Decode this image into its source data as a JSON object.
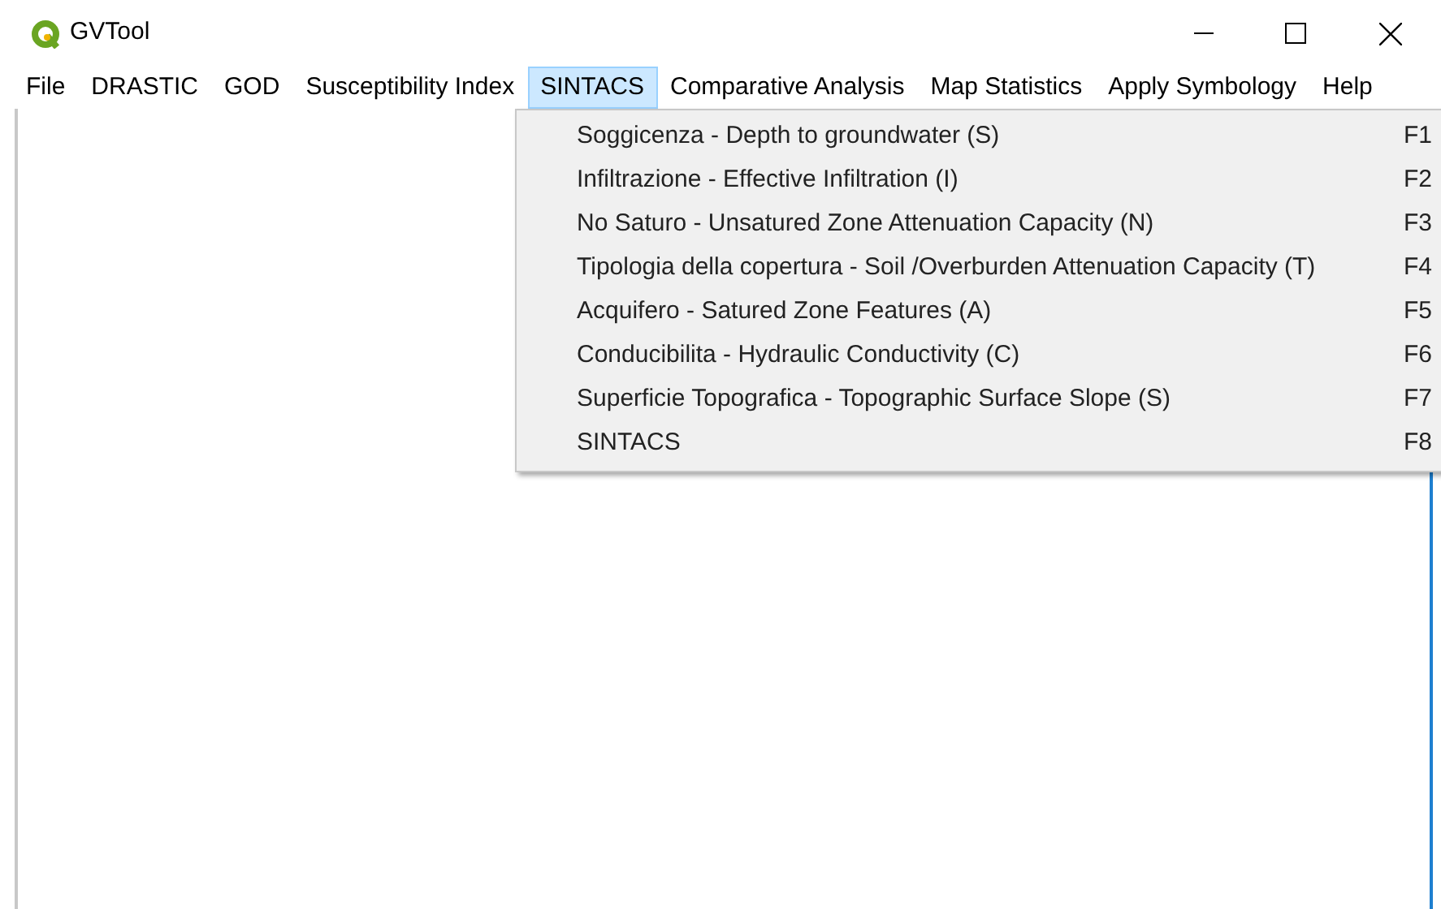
{
  "window": {
    "title": "GVTool"
  },
  "menu_bar": [
    {
      "label": "File",
      "selected": false
    },
    {
      "label": "DRASTIC",
      "selected": false
    },
    {
      "label": "GOD",
      "selected": false
    },
    {
      "label": "Susceptibility Index",
      "selected": false
    },
    {
      "label": "SINTACS",
      "selected": true
    },
    {
      "label": "Comparative Analysis",
      "selected": false
    },
    {
      "label": "Map Statistics",
      "selected": false
    },
    {
      "label": "Apply Symbology",
      "selected": false
    },
    {
      "label": "Help",
      "selected": false
    }
  ],
  "dropdown": [
    {
      "label": "Soggicenza - Depth to groundwater (S)",
      "shortcut": "F1"
    },
    {
      "label": "Infiltrazione - Effective Infiltration (I)",
      "shortcut": "F2"
    },
    {
      "label": "No Saturo - Unsatured Zone Attenuation Capacity (N)",
      "shortcut": "F3"
    },
    {
      "label": "Tipologia della copertura - Soil /Overburden Attenuation Capacity (T)",
      "shortcut": "F4"
    },
    {
      "label": "Acquifero - Satured Zone Features (A)",
      "shortcut": "F5"
    },
    {
      "label": "Conducibilita - Hydraulic Conductivity (C)",
      "shortcut": "F6"
    },
    {
      "label": "Superficie Topografica - Topographic Surface Slope (S)",
      "shortcut": "F7"
    },
    {
      "label": "SINTACS",
      "shortcut": "F8"
    }
  ]
}
